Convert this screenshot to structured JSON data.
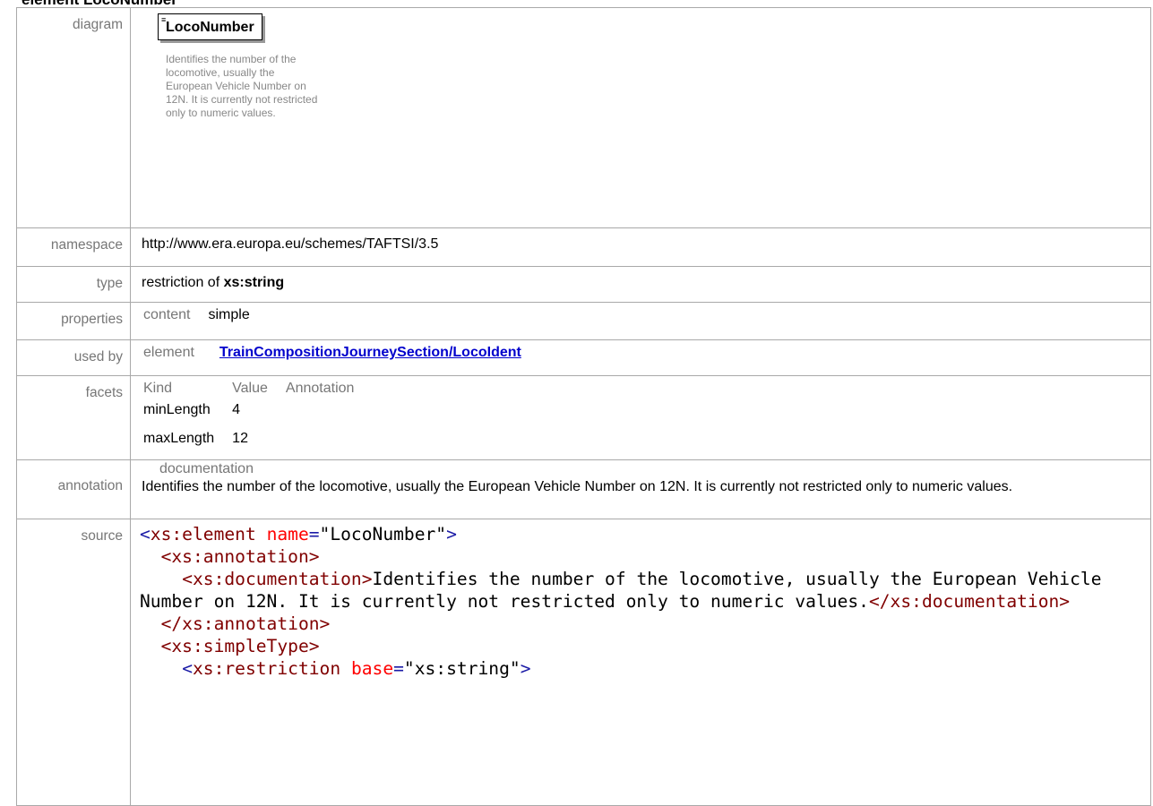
{
  "page_heading": "element LocoNumber",
  "labels": {
    "diagram": "diagram",
    "namespace": "namespace",
    "type": "type",
    "properties": "properties",
    "used_by": "used by",
    "facets": "facets",
    "annotation": "annotation",
    "source": "source"
  },
  "diagram": {
    "element_name": "LocoNumber",
    "doc": "Identifies the number of the locomotive, usually the European Vehicle Number on 12N. It is currently not restricted only to numeric values."
  },
  "namespace": "http://www.era.europa.eu/schemes/TAFTSI/3.5",
  "type": {
    "prefix": "restriction of",
    "base": "xs:string"
  },
  "properties": {
    "key": "content",
    "value": "simple"
  },
  "used_by": {
    "kind": "element",
    "link": "TrainCompositionJourneySection/LocoIdent"
  },
  "facets": {
    "headers": [
      "Kind",
      "Value",
      "Annotation"
    ],
    "rows": [
      {
        "kind": "minLength",
        "value": "4"
      },
      {
        "kind": "maxLength",
        "value": "12"
      }
    ]
  },
  "annotation": {
    "header": "documentation",
    "text": "Identifies the number of the locomotive, usually the European Vehicle Number on 12N. It is currently not restricted only to numeric values."
  },
  "source": {
    "l1_open": "<",
    "l1_tag": "xs:element",
    "l1_attr": "name",
    "l1_eq": "=",
    "l1_val": "\"LocoNumber\"",
    "l1_close": ">",
    "l2": "  <xs:annotation>",
    "l3_open": "    <xs:documentation>",
    "l3_text": "Identifies the number of the locomotive, usually the European Vehicle Number on 12N. It is currently not restricted only to numeric values.",
    "l3_close": "</xs:documentation>",
    "l4": "  </xs:annotation>",
    "l5": "  <xs:simpleType>",
    "l6_open": "    <",
    "l6_tag": "xs:restriction",
    "l6_attr": "base",
    "l6_eq": "=",
    "l6_val": "\"xs:string\"",
    "l6_close": ">"
  }
}
